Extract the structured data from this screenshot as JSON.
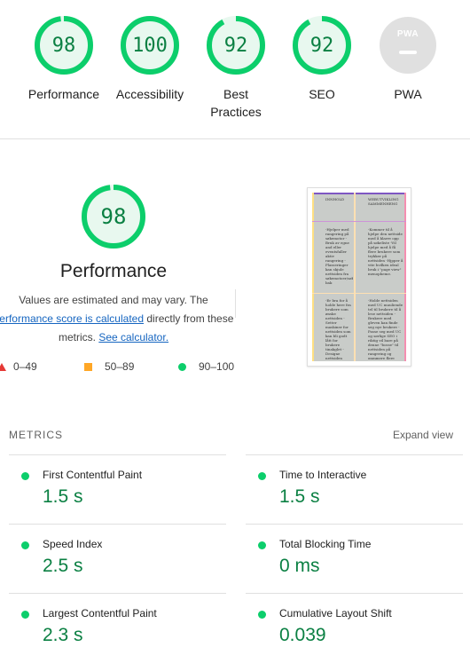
{
  "summary": {
    "gauges": [
      {
        "score": "98",
        "label": "Performance",
        "fraction": 0.98
      },
      {
        "score": "100",
        "label": "Accessibility",
        "fraction": 1.0
      },
      {
        "score": "92",
        "label": "Best Practices",
        "fraction": 0.92
      },
      {
        "score": "92",
        "label": "SEO",
        "fraction": 0.92
      }
    ],
    "pwa": {
      "badge_text": "PWA",
      "label": "PWA"
    }
  },
  "performance": {
    "score": "98",
    "fraction": 0.98,
    "title": "Performance",
    "desc_part1": "Values are estimated and may vary. The",
    "desc_link1": "performance score is calculated",
    "desc_part2": "directly from these metrics.",
    "desc_link2": "See calculator.",
    "legend": {
      "red": "0–49",
      "orange": "50–89",
      "green": "90–100"
    },
    "screenshot": {
      "cells": [
        "INNHOLD",
        "WEBUTVIKLING SAMMENHENG",
        "-Hjelper med rangering på søkemotor -Bruk av egne and eller eventsfaller aktiv rangering -Plasseringer kan skjule nettsiden fra søkemotoer/søke bak",
        "-Kommer til å hjelpe den nettside med å klarre opp på søkeliste -Vil hjelpe med å få flere brukere som trykker på nettsiden -Hjpper å vite hvilken ideal bruk i \"page view\" menopheme.",
        "-Er bra for å holde here fra brukere som ønske nettsiden -Setter maskiner for nettsiden som kan bli godt lått for brukere tinakglet -Designe nettsiden enkelt og fleseleglig",
        "-Holde nettsiden med UC muuliende tel til brukere til å lese nettsiden -Brukere med gleven kan finde seg nye brukere -Passe seg med UC og sørlige SEO i riktig vil bare på denne \"bosse\" til nettsiden på rangering og gammere flere fiskbose"
      ]
    }
  },
  "metrics": {
    "heading": "METRICS",
    "expand_label": "Expand view",
    "items": [
      {
        "name": "First Contentful Paint",
        "value": "1.5 s"
      },
      {
        "name": "Time to Interactive",
        "value": "1.5 s"
      },
      {
        "name": "Speed Index",
        "value": "2.5 s"
      },
      {
        "name": "Total Blocking Time",
        "value": "0 ms"
      },
      {
        "name": "Largest Contentful Paint",
        "value": "2.3 s"
      },
      {
        "name": "Cumulative Layout Shift",
        "value": "0.039"
      }
    ]
  },
  "colors": {
    "pass": "#0cce6b",
    "pass_text": "#0b8043",
    "pass_bg": "#e8f8ef",
    "average": "#ffa726",
    "fail": "#e53935",
    "link": "#1565c0"
  }
}
